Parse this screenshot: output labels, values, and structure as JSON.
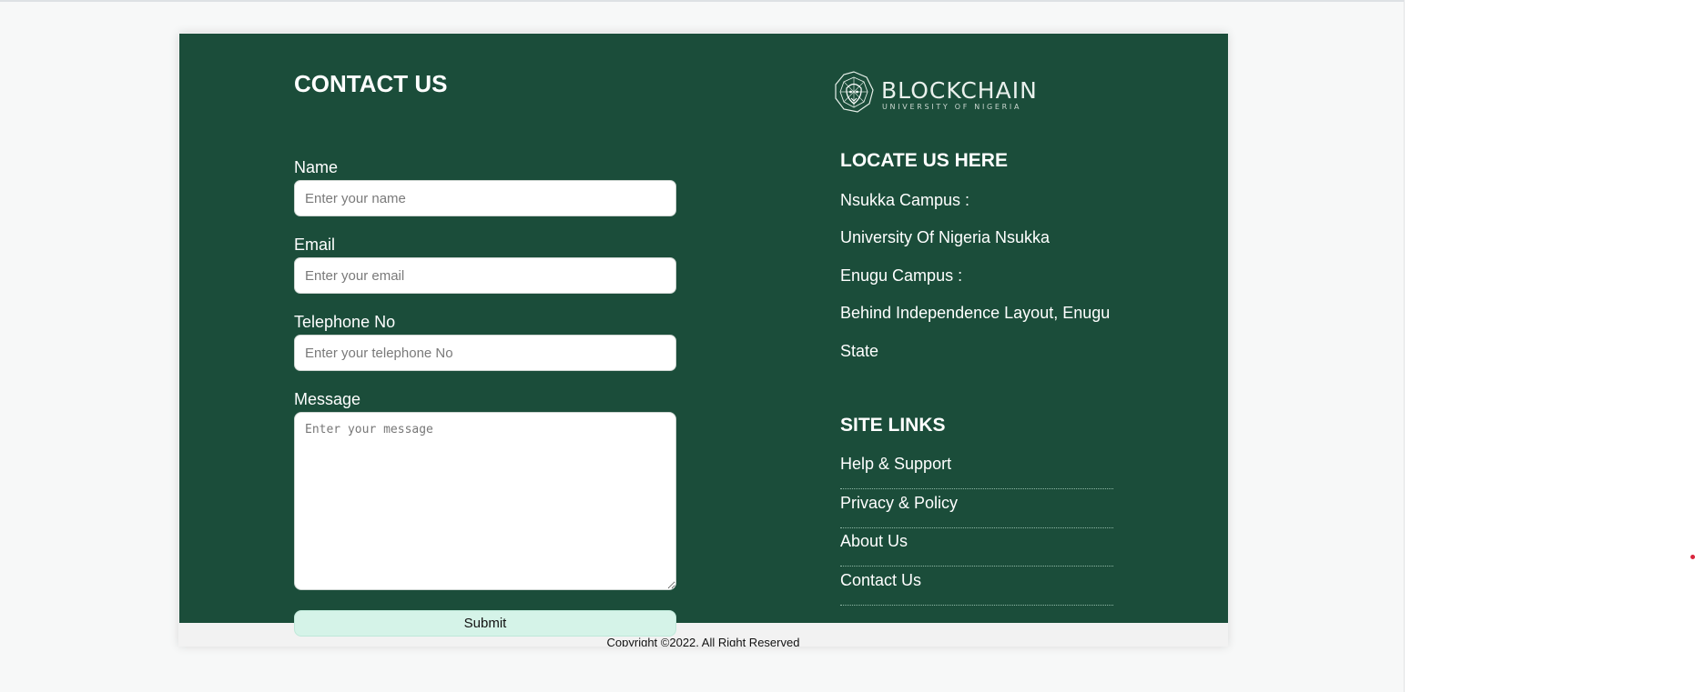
{
  "colors": {
    "panel_background": "#1b4d3a",
    "submit_background": "#d5f3e8",
    "text_light": "#ffffff",
    "accent_dot": "#d9263d"
  },
  "contact": {
    "title": "CONTACT US",
    "name": {
      "label": "Name",
      "placeholder": "Enter your name",
      "value": ""
    },
    "email": {
      "label": "Email",
      "placeholder": "Enter your email",
      "value": ""
    },
    "telephone": {
      "label": "Telephone No",
      "placeholder": "Enter your telephone No",
      "value": ""
    },
    "message": {
      "label": "Message",
      "placeholder": "Enter your message",
      "value": ""
    },
    "submit_label": "Submit"
  },
  "logo": {
    "icon": "lion-geometric-logo-icon",
    "wordmark": "BLOCKCHAIN",
    "subtitle": "UNIVERSITY OF NIGERIA"
  },
  "locate": {
    "title": "LOCATE US HERE",
    "lines": [
      "Nsukka Campus :",
      "University Of Nigeria Nsukka",
      "Enugu Campus :",
      "Behind Independence Layout, Enugu",
      "State"
    ]
  },
  "site_links": {
    "title": "SITE LINKS",
    "items": [
      "Help & Support",
      "Privacy & Policy",
      "About Us",
      "Contact Us"
    ]
  },
  "footer": {
    "copyright": "Copyright ©2022, All Right Reserved"
  }
}
